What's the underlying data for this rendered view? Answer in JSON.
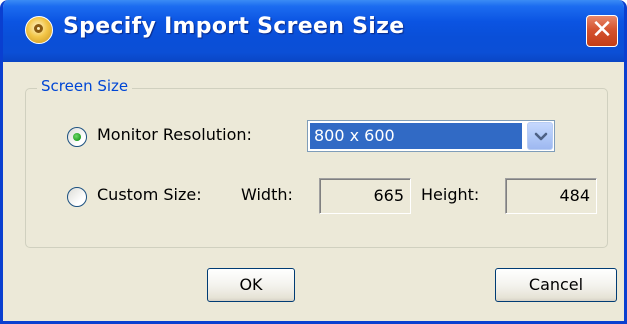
{
  "window": {
    "title": "Specify Import Screen Size",
    "close_symbol": "✕"
  },
  "group": {
    "legend": "Screen Size"
  },
  "monitor_resolution": {
    "label": "Monitor Resolution:",
    "selected": true,
    "value": "800 x 600"
  },
  "custom_size": {
    "label": "Custom Size:",
    "selected": false,
    "width_label": "Width:",
    "width_value": "665",
    "height_label": "Height:",
    "height_value": "484"
  },
  "buttons": {
    "ok": "OK",
    "cancel": "Cancel"
  },
  "colors": {
    "titlebar": "#0a4fd8",
    "dialog_bg": "#ece9d8",
    "legend_text": "#0046d5",
    "selection": "#316ac5",
    "close_button": "#d5532f"
  }
}
